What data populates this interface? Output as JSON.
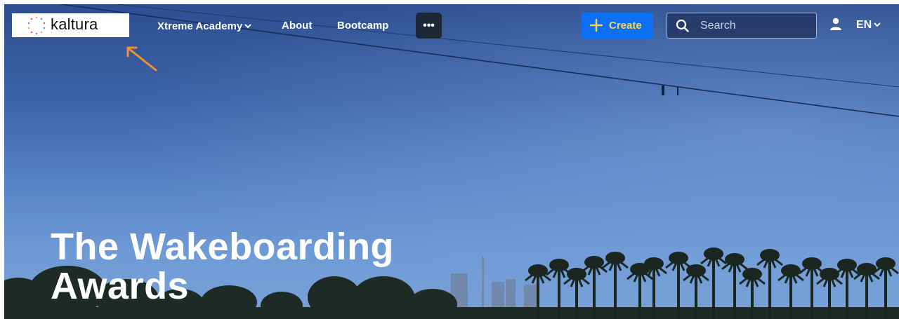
{
  "logo": {
    "text": "kaltura",
    "icon": "kaltura-dots-logo"
  },
  "nav": {
    "items": [
      {
        "label": "Xtreme Academy",
        "has_dropdown": true
      },
      {
        "label": "About"
      },
      {
        "label": "Bootcamp"
      }
    ],
    "more_label": "•••"
  },
  "actions": {
    "create_label": "Create",
    "search_placeholder": "Search",
    "language": "EN"
  },
  "hero": {
    "title_line1": "The Wakeboarding",
    "title_line2": "Awards"
  },
  "colors": {
    "create_bg": "#0d6ff2",
    "create_text": "#f6d55c",
    "more_bg": "#1c2738",
    "annotation_arrow": "#f0922e",
    "sky_top": "#2e4f90",
    "sky_bottom": "#7aa2d6"
  },
  "icons": [
    "chevron-down-icon",
    "ellipsis-icon",
    "plus-icon",
    "search-icon",
    "user-icon",
    "annotation-arrow"
  ]
}
